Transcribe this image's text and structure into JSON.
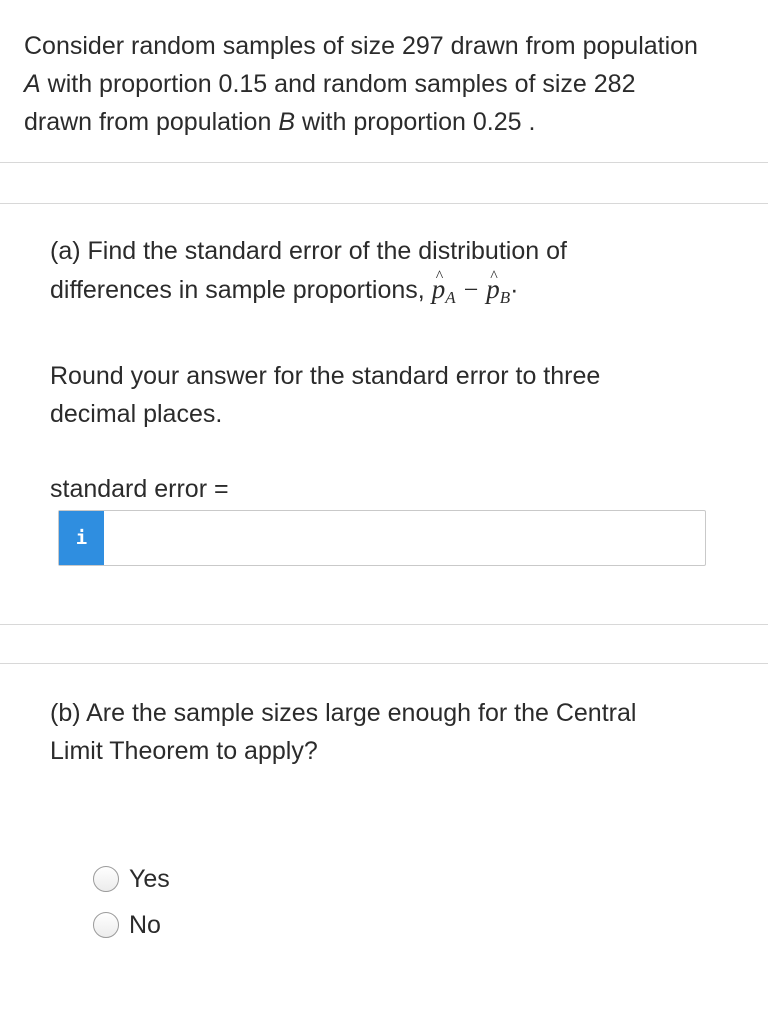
{
  "intro": {
    "line1": "Consider random samples of size 297 drawn from population",
    "line2_var": "A",
    "line2_rest": " with proportion 0.15 and random samples of size 282",
    "line3_pre": "drawn from population ",
    "line3_var": "B",
    "line3_rest": " with proportion 0.25 ."
  },
  "part_a": {
    "line1": "(a) Find the standard error of the distribution of",
    "line2": "differences in sample proportions, ",
    "p_symbol": "p",
    "hat_symbol": "^",
    "sub_a": "A",
    "minus": "−",
    "sub_b": "B",
    "end_punct": "·",
    "round_line1": "Round your answer for the standard error to three",
    "round_line2": "decimal places.",
    "field_label": "standard error =",
    "info_icon_glyph": "i",
    "answer_value": ""
  },
  "part_b": {
    "line1": "(b) Are the sample sizes large enough for the Central",
    "line2": "Limit Theorem to apply?",
    "options": [
      {
        "label": "Yes"
      },
      {
        "label": "No"
      }
    ]
  }
}
